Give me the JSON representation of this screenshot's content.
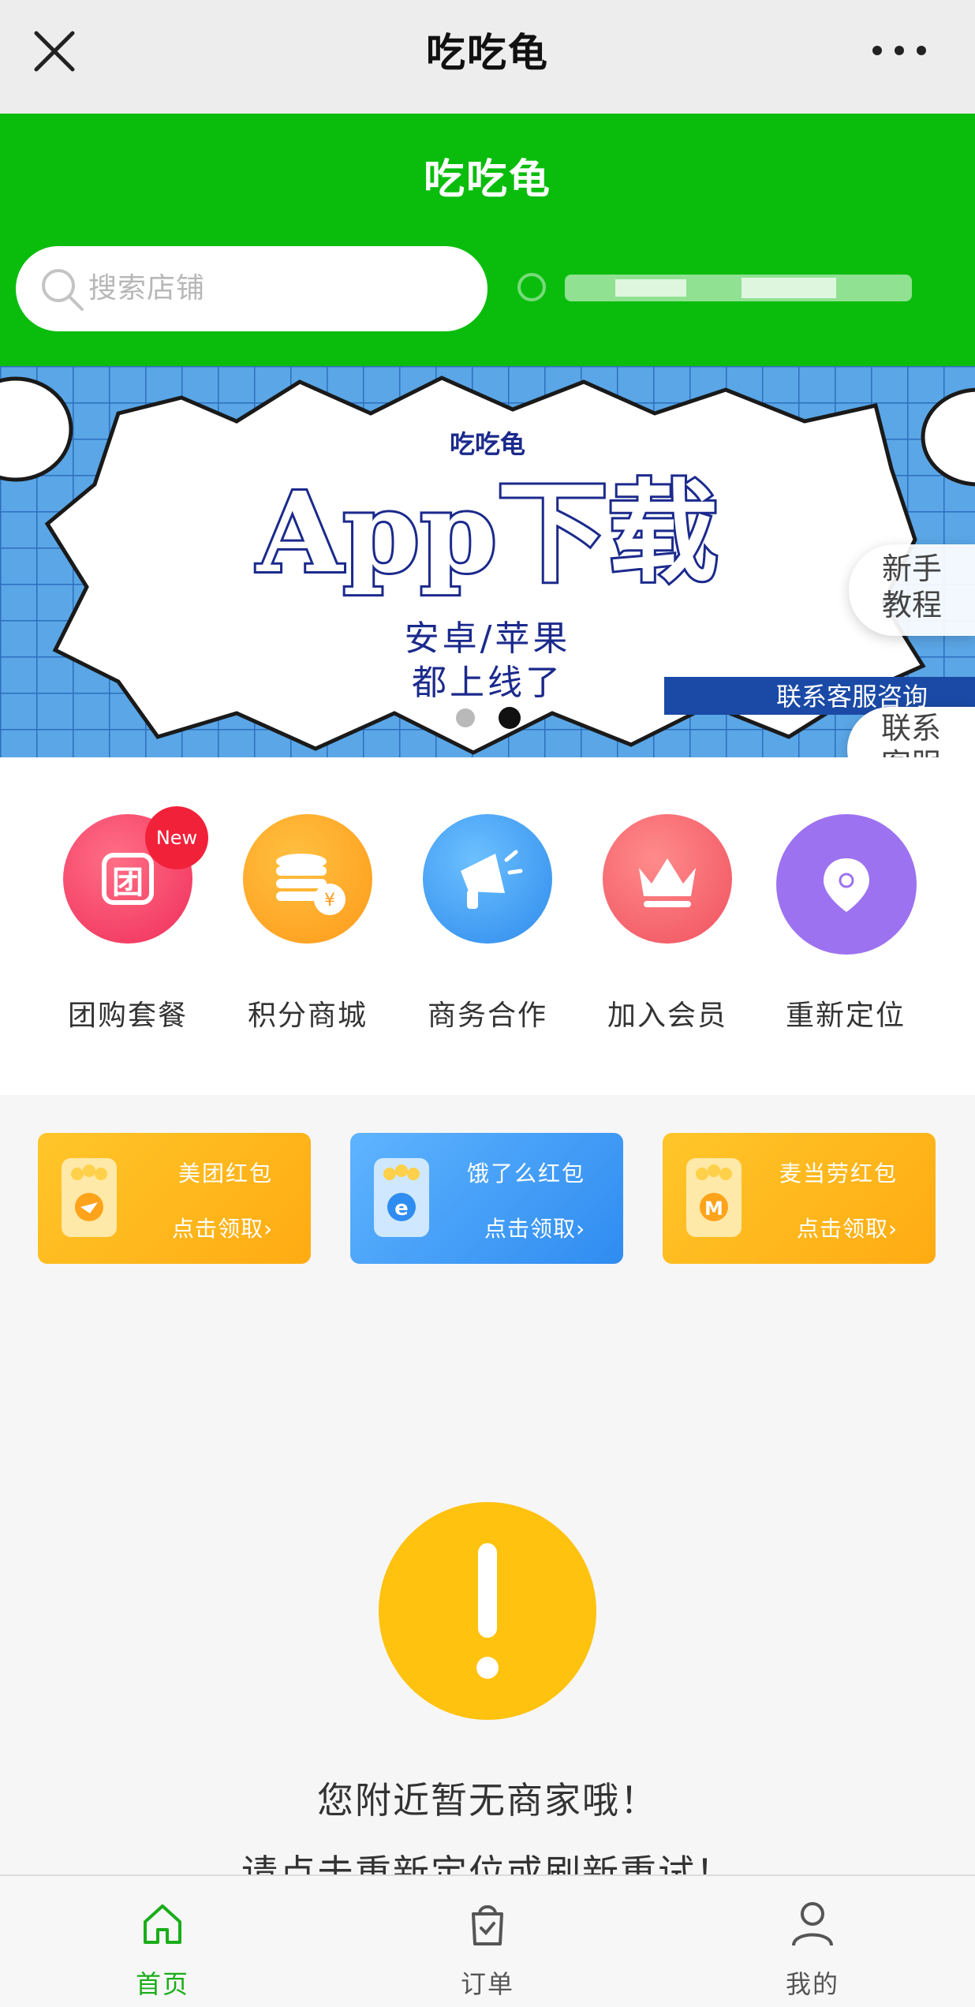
{
  "nav": {
    "title": "吃吃龟",
    "close_icon": "close-icon",
    "more_icon": "more-icon"
  },
  "header": {
    "brand": "吃吃龟",
    "bg_color": "#0abd0d",
    "search": {
      "placeholder": "搜索店铺"
    }
  },
  "banner": {
    "brand": "吃吃龟",
    "headline": "App下载",
    "line1": "安卓/苹果",
    "line2": "都上线了",
    "ribbon": "联系客服咨询",
    "dots": 2,
    "active_dot": 2
  },
  "floating": {
    "guide": "新手\n教程",
    "service": "联系\n客服"
  },
  "features": [
    {
      "label": "团购套餐",
      "badge": "New",
      "icon": "group-buy-icon",
      "color": "#f24b6a"
    },
    {
      "label": "积分商城",
      "icon": "coins-icon",
      "color": "#ffa51f"
    },
    {
      "label": "商务合作",
      "icon": "megaphone-icon",
      "color": "#3d9bf3"
    },
    {
      "label": "加入会员",
      "icon": "crown-icon",
      "color": "#f56770"
    },
    {
      "label": "重新定位",
      "icon": "location-icon",
      "color": "#9d72f0"
    }
  ],
  "coupons": [
    {
      "title": "美团红包",
      "action": "点击领取›",
      "color": "#ffb619"
    },
    {
      "title": "饿了么红包",
      "action": "点击领取›",
      "color": "#3c9cf4"
    },
    {
      "title": "麦当劳红包",
      "action": "点击领取›",
      "color": "#ffb619"
    }
  ],
  "empty": {
    "line1": "您附近暂无商家哦！",
    "line2": "请点击重新定位或刷新重试！",
    "icon": "warning-icon",
    "color": "#ffc20e"
  },
  "tabs": [
    {
      "label": "首页",
      "icon": "home-icon",
      "active": true
    },
    {
      "label": "订单",
      "icon": "order-bag-icon",
      "active": false
    },
    {
      "label": "我的",
      "icon": "user-icon",
      "active": false
    }
  ],
  "colors": {
    "active": "#1aad19",
    "inactive": "#555555"
  }
}
